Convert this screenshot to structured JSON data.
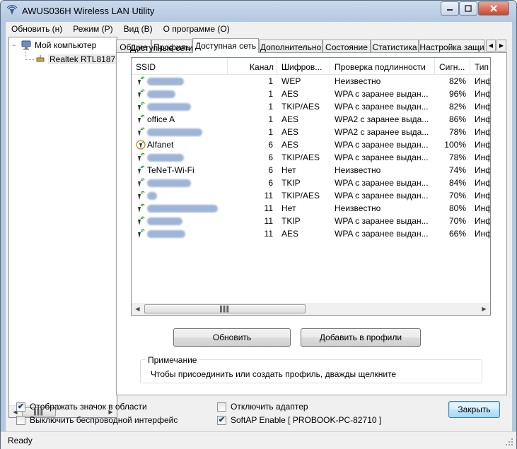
{
  "window": {
    "title": "AWUS036H Wireless LAN Utility"
  },
  "menu": [
    "Обновить (н)",
    "Режим (P)",
    "Вид (B)",
    "О программе (O)"
  ],
  "tree": {
    "root": "Мой компьютер",
    "child": "Realtek RTL8187"
  },
  "tabs": [
    "Общие",
    "Профиль",
    "Доступная сеть",
    "Дополнительно",
    "Состояние",
    "Статистика",
    "Настройка защи"
  ],
  "active_tab": "Доступная сеть",
  "section_label": "Доступные сети",
  "columns": [
    "SSID",
    "Канал",
    "Шифров...",
    "Проверка подлинности",
    "Сигн...",
    "Тип"
  ],
  "networks": [
    {
      "ssid": "",
      "channel": "1",
      "enc": "WEP",
      "auth": "Неизвестно",
      "signal": "82%",
      "type": "Инф"
    },
    {
      "ssid": "",
      "channel": "1",
      "enc": "AES",
      "auth": "WPA с заранее выдан...",
      "signal": "96%",
      "type": "Инф"
    },
    {
      "ssid": "",
      "channel": "1",
      "enc": "TKIP/AES",
      "auth": "WPA с заранее выдан...",
      "signal": "82%",
      "type": "Инф"
    },
    {
      "ssid": "office A",
      "channel": "1",
      "enc": "AES",
      "auth": "WPA2 с заранее выда...",
      "signal": "86%",
      "type": "Инф"
    },
    {
      "ssid": "",
      "channel": "1",
      "enc": "AES",
      "auth": "WPA2 с заранее выда...",
      "signal": "78%",
      "type": "Инф"
    },
    {
      "ssid": "Alfanet",
      "channel": "6",
      "enc": "AES",
      "auth": "WPA с заранее выдан...",
      "signal": "100%",
      "type": "Инф"
    },
    {
      "ssid": "",
      "channel": "6",
      "enc": "TKIP/AES",
      "auth": "WPA с заранее выдан...",
      "signal": "78%",
      "type": "Инф"
    },
    {
      "ssid": "TeNeT-Wi-Fi",
      "channel": "6",
      "enc": "Нет",
      "auth": "Неизвестно",
      "signal": "74%",
      "type": "Инф"
    },
    {
      "ssid": "",
      "channel": "6",
      "enc": "TKIP",
      "auth": "WPA с заранее выдан...",
      "signal": "84%",
      "type": "Инф"
    },
    {
      "ssid": "",
      "channel": "11",
      "enc": "TKIP/AES",
      "auth": "WPA с заранее выдан...",
      "signal": "70%",
      "type": "Инф"
    },
    {
      "ssid": "",
      "channel": "11",
      "enc": "Нет",
      "auth": "Неизвестно",
      "signal": "80%",
      "type": "Инф"
    },
    {
      "ssid": "",
      "channel": "11",
      "enc": "TKIP",
      "auth": "WPA с заранее выдан...",
      "signal": "70%",
      "type": "Инф"
    },
    {
      "ssid": "",
      "channel": "11",
      "enc": "AES",
      "auth": "WPA с заранее выдан...",
      "signal": "66%",
      "type": "Инф"
    }
  ],
  "buttons": {
    "refresh": "Обновить",
    "add_profile": "Добавить в профили",
    "close": "Закрыть"
  },
  "note": {
    "title": "Примечание",
    "text": "Чтобы присоединить или создать профиль, дважды щелкните"
  },
  "checks": {
    "tray_icon": {
      "label": "Отображать значок в области",
      "checked": true
    },
    "disable_wireless": {
      "label": "Выключить беспроводной интерфейс",
      "checked": false
    },
    "disable_adapter": {
      "label": "Отключить адаптер",
      "checked": false
    },
    "softap": {
      "label": "SoftAP Enable [ PROBOOK-PC-82710 ]",
      "checked": true
    }
  },
  "status": "Ready",
  "colors": {
    "title_bar": "#b4c8e0",
    "signal_icon": "#2a9d2a",
    "default_button": "#3c7fb1"
  }
}
